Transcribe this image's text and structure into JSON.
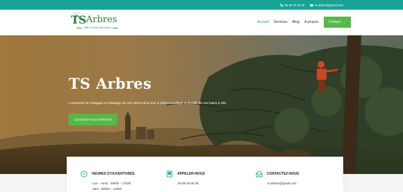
{
  "topbar": {
    "phone": "06 59 30 00 39",
    "email": "ts.arbres@gmail.com",
    "phone_icon": "phone-icon",
    "email_icon": "envelope-icon"
  },
  "header": {
    "logo": {
      "mark": "TS",
      "name": "Arbres",
      "tagline": "Taille et Soins des Arbres"
    },
    "nav": {
      "items": [
        "Accueil",
        "Services",
        "Blog",
        "A propos"
      ],
      "active": "Accueil",
      "contact_label": "Contact",
      "contact_arrow": "→"
    }
  },
  "hero": {
    "title": "TS Arbres",
    "subtitle": "L'expertise de l'élagage et l'abattage de vos arbres ainsi que le débroussaillage et la taille de vos haies à Albi.",
    "cta_label": "Contactez-nous maintenant"
  },
  "info": {
    "hours": {
      "title": "HEURES D'OUVERTURES",
      "line1": "Lun – Vend : 09h00 – 17h30",
      "line2": "Sam : 09h00 – 12h00",
      "icon": "clock-icon"
    },
    "call": {
      "title": "APPELER-NOUS",
      "line1": "06 59 30 00 39",
      "icon": "phone-icon"
    },
    "contact": {
      "title": "CONTACTEZ-NOUS",
      "line1": "ts.arbres@gmail.com",
      "icon": "envelope-open-icon"
    }
  },
  "colors": {
    "topbar": "#19a394",
    "accent_green": "#54b94a",
    "logo_green": "#2d7a3d",
    "icon_teal": "#19a394"
  }
}
